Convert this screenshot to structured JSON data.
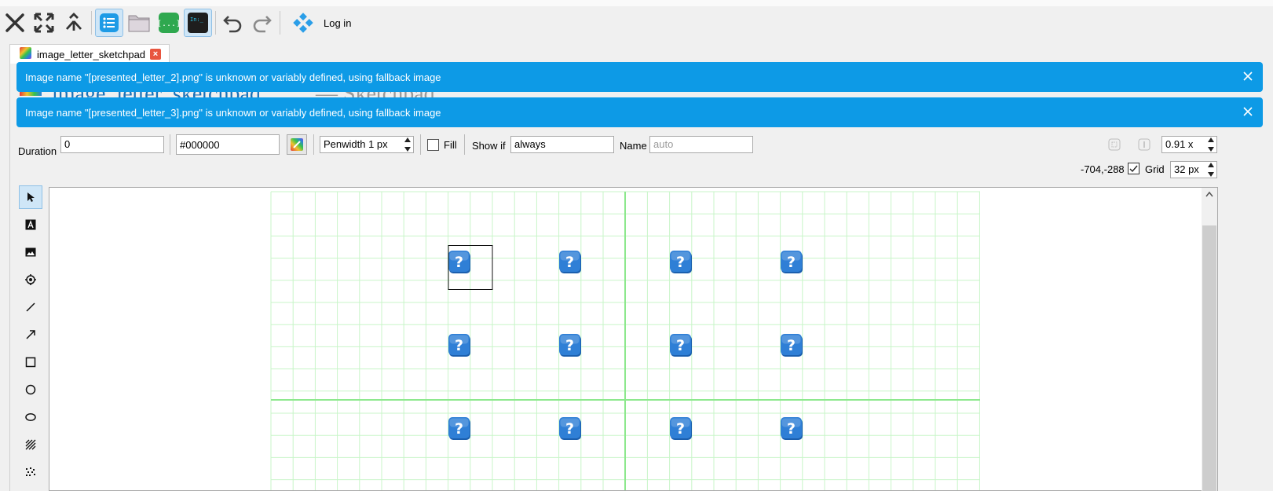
{
  "toolbar": {
    "buttons": [
      {
        "name": "close-icon"
      },
      {
        "name": "fullscreen-icon"
      },
      {
        "name": "merge-icon"
      },
      {
        "name": "overview-icon"
      },
      {
        "name": "folder-icon"
      },
      {
        "name": "variables-icon"
      },
      {
        "name": "console-icon"
      },
      {
        "name": "undo-icon"
      },
      {
        "name": "redo-icon"
      }
    ],
    "console_glyph": "In:_",
    "variables_glyph": "[...]",
    "login_label": "Log in"
  },
  "tab": {
    "label": "image_letter_sketchpad",
    "close_glyph": "×"
  },
  "background_header": {
    "title": "image_letter_sketchpad",
    "subtitle": "— Sketchpad"
  },
  "notifications": [
    {
      "message": "Image name \"[presented_letter_2].png\" is unknown or variably defined, using fallback image"
    },
    {
      "message": "Image name \"[presented_letter_3].png\" is unknown or variably defined, using fallback image"
    }
  ],
  "properties": {
    "duration_label": "Duration",
    "duration_value": "0",
    "color_value": "#000000",
    "penwidth_value": "Penwidth 1 px",
    "fill_label": "Fill",
    "fill_checked": false,
    "showif_label": "Show if",
    "showif_value": "always",
    "name_label": "Name",
    "name_placeholder": "auto",
    "zoom_value": "0.91 x",
    "coords": "-704,-288",
    "grid_label": "Grid",
    "grid_checked": true,
    "grid_value": "32 px"
  },
  "tools": [
    {
      "name": "select-tool-icon",
      "active": true
    },
    {
      "name": "text-tool-icon",
      "active": false
    },
    {
      "name": "image-tool-icon",
      "active": false
    },
    {
      "name": "fixdot-tool-icon",
      "active": false
    },
    {
      "name": "line-tool-icon",
      "active": false
    },
    {
      "name": "arrow-tool-icon",
      "active": false
    },
    {
      "name": "rect-tool-icon",
      "active": false
    },
    {
      "name": "circle-tool-icon",
      "active": false
    },
    {
      "name": "ellipse-tool-icon",
      "active": false
    },
    {
      "name": "gabor-tool-icon",
      "active": false
    },
    {
      "name": "noise-tool-icon",
      "active": false
    }
  ],
  "canvas": {
    "fallback_glyph": "?",
    "image_rows": 3,
    "image_cols": 4,
    "selected_index": 0
  },
  "colors": {
    "accent": "#0d9ae6",
    "grid_line": "#c8f5c8",
    "grid_major": "#8de88d",
    "fallback_icon": "#2f7fd6"
  }
}
